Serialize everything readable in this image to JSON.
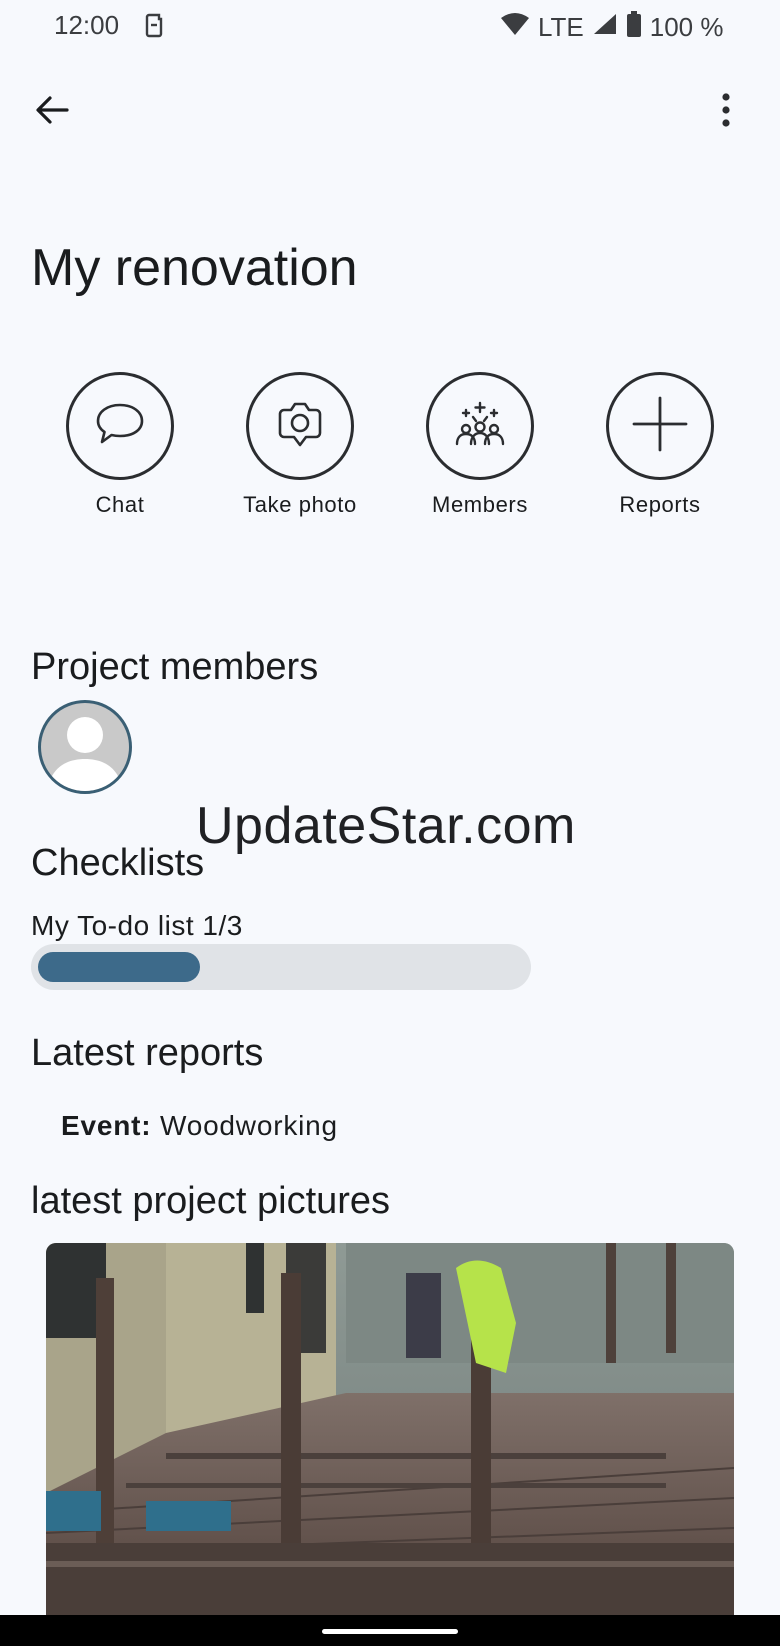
{
  "status_bar": {
    "time": "12:00",
    "network": "LTE",
    "battery": "100 %"
  },
  "app_bar": {
    "back_icon": "arrow-back-icon",
    "menu_icon": "more-vert-icon"
  },
  "project": {
    "title": "My renovation"
  },
  "actions": [
    {
      "label": "Chat",
      "icon": "chat-bubble-icon"
    },
    {
      "label": "Take photo",
      "icon": "camera-icon"
    },
    {
      "label": "Members",
      "icon": "members-icon"
    },
    {
      "label": "Reports",
      "icon": "plus-icon"
    }
  ],
  "members": {
    "heading": "Project members",
    "avatar_icon": "person-avatar-icon"
  },
  "watermark": "UpdateStar.com",
  "checklists": {
    "heading": "Checklists",
    "items": [
      {
        "name": "My To-do list 1/3",
        "progress": 0.333
      }
    ]
  },
  "reports": {
    "heading": "Latest reports",
    "items": [
      {
        "key": "Event:",
        "value": "Woodworking"
      }
    ]
  },
  "pictures": {
    "heading": "latest project pictures"
  },
  "colors": {
    "background": "#f7f9fd",
    "progress_fill": "#3d6a8a",
    "progress_track": "#e0e3e7"
  }
}
